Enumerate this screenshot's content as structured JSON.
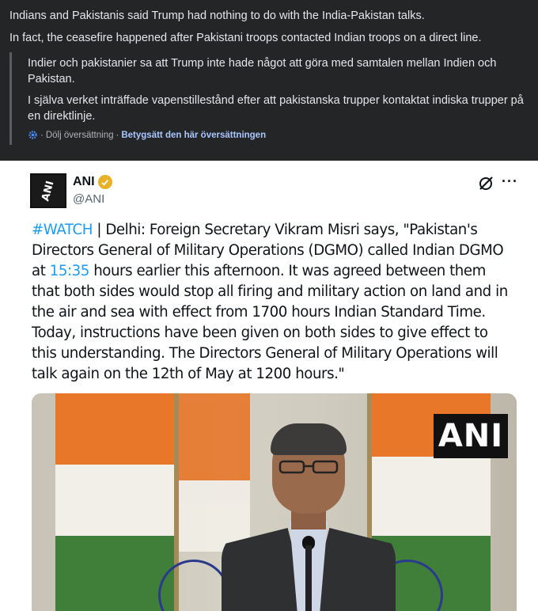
{
  "post": {
    "line1": "Indians and Pakistanis said Trump had nothing to do with the India-Pakistan talks.",
    "line2": "In fact, the ceasefire happened after Pakistani troops contacted Indian troops on a direct line."
  },
  "translation": {
    "line1": "Indier och pakistanier sa att Trump inte hade något att göra med samtalen mellan Indien och Pakistan.",
    "line2": "I själva verket inträffade vapenstillestånd efter att pakistanska trupper kontaktat indiska trupper på en direktlinje.",
    "separator1": "·",
    "hide_link": "Dölj översättning",
    "separator2": "·",
    "rate_link": "Betygsätt den här översättningen",
    "icon": "gear-icon",
    "accent_color": "#a9c7ff"
  },
  "tweet": {
    "avatar_text": "ANI",
    "name": "ANI",
    "handle": "@ANI",
    "verified_color": "#e8b12a",
    "more": "···",
    "hashtag": "#WATCH",
    "text_a": " | Delhi: Foreign Secretary Vikram Misri says, \"Pakistan's Directors General of Military Operations (DGMO) called Indian DGMO at ",
    "time": "15:35",
    "text_b": " hours earlier this afternoon. It was agreed between them that both sides would stop all firing and military action on land and in the air and sea with effect from 1700 hours Indian Standard Time. Today, instructions have been given on both sides to give effect to this understanding. The Directors General of Military Operations will talk again on the 12th of May at 1200 hours.\"",
    "link_color": "#1d9bf0",
    "video_logo": "ANI"
  }
}
